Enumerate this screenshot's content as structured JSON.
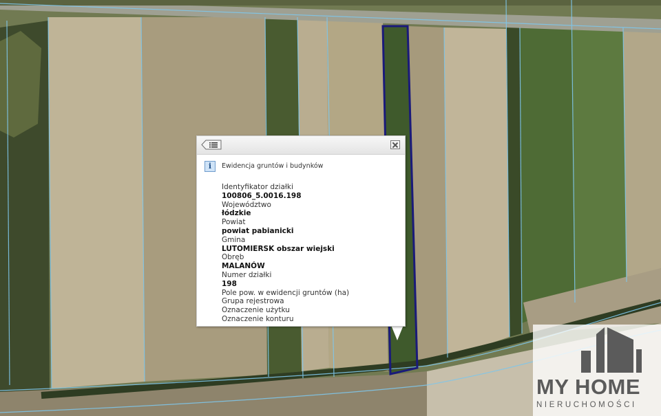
{
  "popup": {
    "title": "Ewidencja gruntów i budynków",
    "icons": {
      "list": "list-icon",
      "close": "close-icon",
      "info": "info-icon"
    },
    "info_glyph": "i",
    "rows": [
      {
        "label": "Identyfikator działki"
      },
      {
        "value": "100806_5.0016.198"
      },
      {
        "label": "Województwo"
      },
      {
        "value": "łódzkie"
      },
      {
        "label": "Powiat"
      },
      {
        "value": "powiat pabianicki"
      },
      {
        "label": "Gmina"
      },
      {
        "value": "LUTOMIERSK obszar wiejski"
      },
      {
        "label": "Obręb"
      },
      {
        "value": "MALANÓW"
      },
      {
        "label": "Numer działki"
      },
      {
        "value": "198"
      },
      {
        "label": "Pole pow. w ewidencji gruntów (ha)"
      },
      {
        "label": "Grupa rejestrowa"
      },
      {
        "label": "Oznaczenie użytku"
      },
      {
        "label": "Oznaczenie konturu"
      }
    ]
  },
  "watermark": {
    "title": "MY HOME",
    "subtitle": "NIERUCHOMOŚCI"
  },
  "colors": {
    "parcel_outline": "#1a1a7a",
    "parcel_lines": "#7fc6ea"
  }
}
